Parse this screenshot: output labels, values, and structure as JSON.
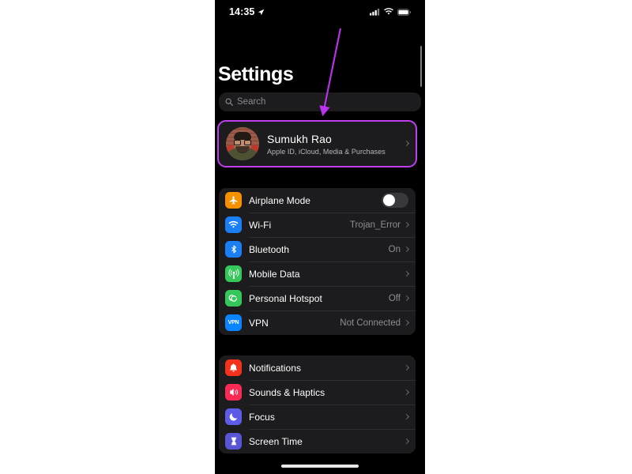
{
  "statusbar": {
    "time": "14:35",
    "location_icon": "location-arrow-icon",
    "cellular_icon": "cellular-bars-icon",
    "wifi_icon": "wifi-icon",
    "battery_icon": "battery-full-icon"
  },
  "header": {
    "title": "Settings"
  },
  "search": {
    "placeholder": "Search",
    "value": "",
    "icon": "search-icon"
  },
  "apple_id": {
    "name": "Sumukh Rao",
    "subtitle": "Apple ID, iCloud, Media & Purchases",
    "avatar": "user-avatar",
    "chevron": "chevron-right-icon",
    "highlight_color": "#c23ff0"
  },
  "annotation": {
    "type": "arrow",
    "color": "#bb33ee",
    "points_to": "apple-id-row"
  },
  "groups": [
    {
      "id": "connectivity",
      "rows": [
        {
          "label": "Airplane Mode",
          "value": "",
          "icon": "airplane-icon",
          "icon_color": "#f59000",
          "control": "toggle",
          "toggle_on": false
        },
        {
          "label": "Wi-Fi",
          "value": "Trojan_Error",
          "icon": "wifi-icon",
          "icon_color": "#1a7ef5",
          "control": "chevron"
        },
        {
          "label": "Bluetooth",
          "value": "On",
          "icon": "bluetooth-icon",
          "icon_color": "#1a7ef5",
          "control": "chevron"
        },
        {
          "label": "Mobile Data",
          "value": "",
          "icon": "cellular-antenna-icon",
          "icon_color": "#35c759",
          "control": "chevron"
        },
        {
          "label": "Personal Hotspot",
          "value": "Off",
          "icon": "hotspot-icon",
          "icon_color": "#35c759",
          "control": "chevron"
        },
        {
          "label": "VPN",
          "value": "Not Connected",
          "icon": "vpn-icon",
          "icon_color": "#0a84ff",
          "control": "chevron"
        }
      ]
    },
    {
      "id": "system",
      "rows": [
        {
          "label": "Notifications",
          "value": "",
          "icon": "bell-icon",
          "icon_color": "#f4321c",
          "control": "chevron"
        },
        {
          "label": "Sounds & Haptics",
          "value": "",
          "icon": "speaker-icon",
          "icon_color": "#fa2a55",
          "control": "chevron"
        },
        {
          "label": "Focus",
          "value": "",
          "icon": "moon-icon",
          "icon_color": "#5e5ce6",
          "control": "chevron"
        },
        {
          "label": "Screen Time",
          "value": "",
          "icon": "hourglass-icon",
          "icon_color": "#5856d6",
          "control": "chevron"
        }
      ]
    }
  ],
  "home_indicator": "home-indicator"
}
